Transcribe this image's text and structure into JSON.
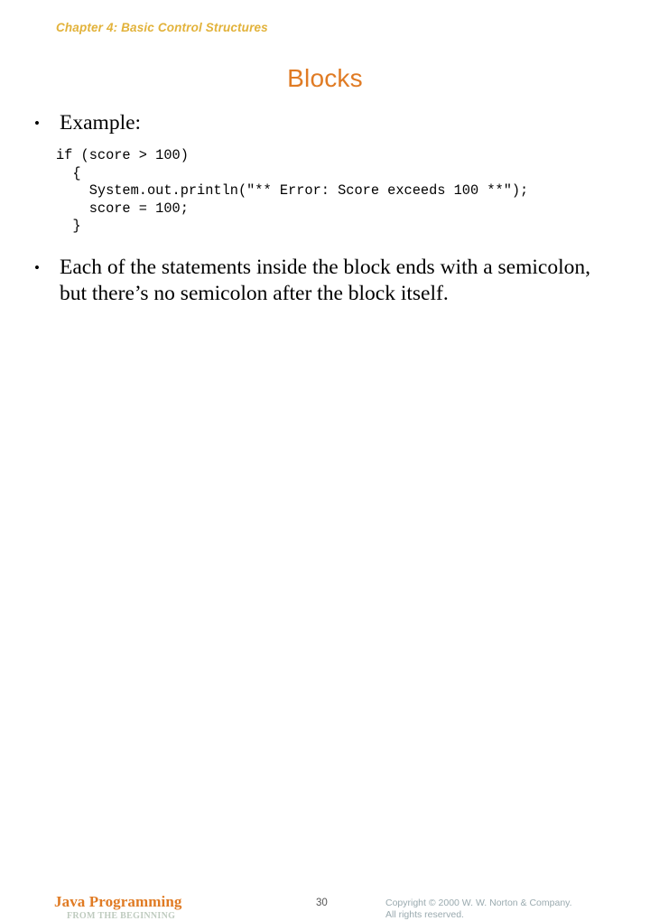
{
  "slide": {
    "chapter_header": "Chapter 4: Basic Control Structures",
    "title": "Blocks",
    "bullets": [
      {
        "text": "Example:"
      },
      {
        "text": "Each of the statements inside the block ends with a semicolon, but there’s no semicolon after the block itself."
      }
    ],
    "code": "if (score > 100)\n  {\n    System.out.println(\"** Error: Score exceeds 100 **\");\n    score = 100;\n  }",
    "footer": {
      "logo_main": "Java Programming",
      "logo_sub": "FROM THE BEGINNING",
      "page_number": "30",
      "copyright_line1": "Copyright © 2000 W. W. Norton & Company.",
      "copyright_line2": "All rights reserved."
    },
    "colors": {
      "chapter_header": "#E2B23A",
      "title": "#E07B24",
      "logo_main": "#E07B24",
      "logo_sub": "#BFCBBF",
      "copyright": "#9AAAAF",
      "body_text": "#000000",
      "background": "#FFFFFF"
    }
  }
}
